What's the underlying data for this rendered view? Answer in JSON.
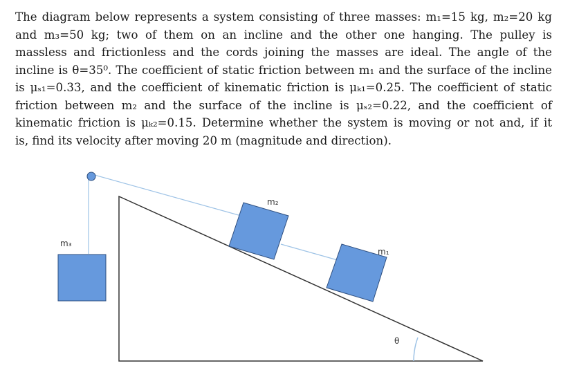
{
  "problem": {
    "lines": [
      "The diagram below represents a system consisting of three masses: m₁=15 kg, m₂=20 kg",
      "and m₃=50 kg; two of them on an incline and the other one hanging. The pulley is",
      "massless and frictionless and the cords joining the masses are ideal. The angle of the",
      "incline is θ=35⁰. The coefficient of static friction between m₁ and the surface of the incline",
      "is μₛ₁=0.33, and the coefficient of kinematic friction is μₖ₁=0.25. The coefficient of static",
      "friction between m₂ and the surface of the incline is μₛ₂=0.22, and the coefficient of",
      "kinematic friction is μₖ₂=0.15. Determine whether the system is moving or not and, if it",
      "is, find its velocity after moving 20 m (magnitude and direction)."
    ]
  },
  "diagram": {
    "labels": {
      "m3": "m₃",
      "m2": "m₂",
      "m1": "m₁",
      "theta": "θ"
    },
    "colors": {
      "block_fill": "#6699dd",
      "block_stroke": "#2f4f7f",
      "incline_stroke": "#333333",
      "cord": "#9ec3e6",
      "pulley": "#6699dd",
      "angle_arc": "#9ec3e6"
    }
  }
}
